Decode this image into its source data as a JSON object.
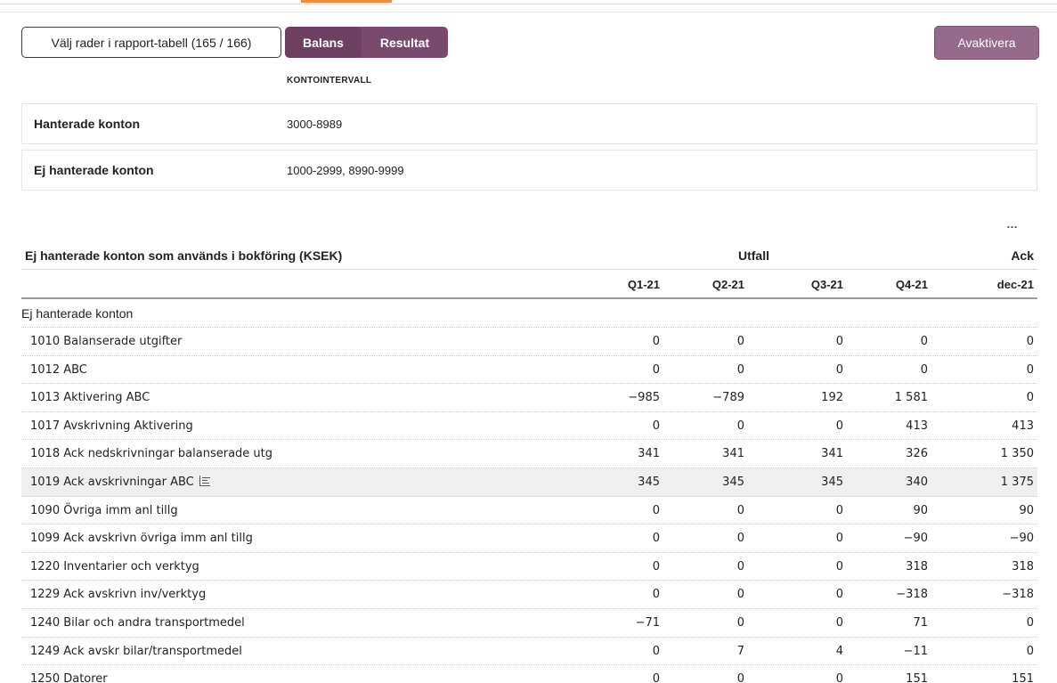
{
  "toolbar": {
    "select_rows_label": "Välj rader i rapport-tabell (165 / 166)",
    "seg_balans": "Balans",
    "seg_resultat": "Resultat",
    "deactivate_label": "Avaktivera"
  },
  "interval": {
    "header": "KONTOINTERVALL",
    "handled_key": "Hanterade konton",
    "handled_value": "3000-8989",
    "unhandled_key": "Ej hanterade konton",
    "unhandled_value": "1000-2999, 8990-9999"
  },
  "more_label": "…",
  "table": {
    "title": "Ej hanterade konton som används i bokföring (KSEK)",
    "group_utfall": "Utfall",
    "group_ack": "Ack",
    "columns": [
      "Q1-21",
      "Q2-21",
      "Q3-21",
      "Q4-21",
      "dec-21"
    ],
    "section_label": "Ej hanterade konton",
    "rows": [
      {
        "name": "1010 Balanserade utgifter",
        "values": [
          "0",
          "0",
          "0",
          "0",
          "0"
        ]
      },
      {
        "name": "1012 ABC",
        "values": [
          "0",
          "0",
          "0",
          "0",
          "0"
        ]
      },
      {
        "name": "1013 Aktivering ABC",
        "values": [
          "−985",
          "−789",
          "192",
          "1 581",
          "0"
        ]
      },
      {
        "name": "1017 Avskrivning Aktivering",
        "values": [
          "0",
          "0",
          "0",
          "413",
          "413"
        ]
      },
      {
        "name": "1018 Ack nedskrivningar balanserade utg",
        "values": [
          "341",
          "341",
          "341",
          "326",
          "1 350"
        ]
      },
      {
        "name": "1019 Ack avskrivningar ABC",
        "values": [
          "345",
          "345",
          "345",
          "340",
          "1 375"
        ]
      },
      {
        "name": "1090 Övriga imm anl tillg",
        "values": [
          "0",
          "0",
          "0",
          "90",
          "90"
        ]
      },
      {
        "name": "1099 Ack avskrivn övriga imm anl tillg",
        "values": [
          "0",
          "0",
          "0",
          "−90",
          "−90"
        ]
      },
      {
        "name": "1220 Inventarier och verktyg",
        "values": [
          "0",
          "0",
          "0",
          "318",
          "318"
        ]
      },
      {
        "name": "1229 Ack avskrivn inv/verktyg",
        "values": [
          "0",
          "0",
          "0",
          "−318",
          "−318"
        ]
      },
      {
        "name": "1240 Bilar och andra transportmedel",
        "values": [
          "−71",
          "0",
          "0",
          "71",
          "0"
        ]
      },
      {
        "name": "1249 Ack avskr bilar/transportmedel",
        "values": [
          "0",
          "7",
          "4",
          "−11",
          "0"
        ]
      },
      {
        "name": "1250 Datorer",
        "values": [
          "0",
          "0",
          "0",
          "151",
          "151"
        ]
      }
    ]
  }
}
